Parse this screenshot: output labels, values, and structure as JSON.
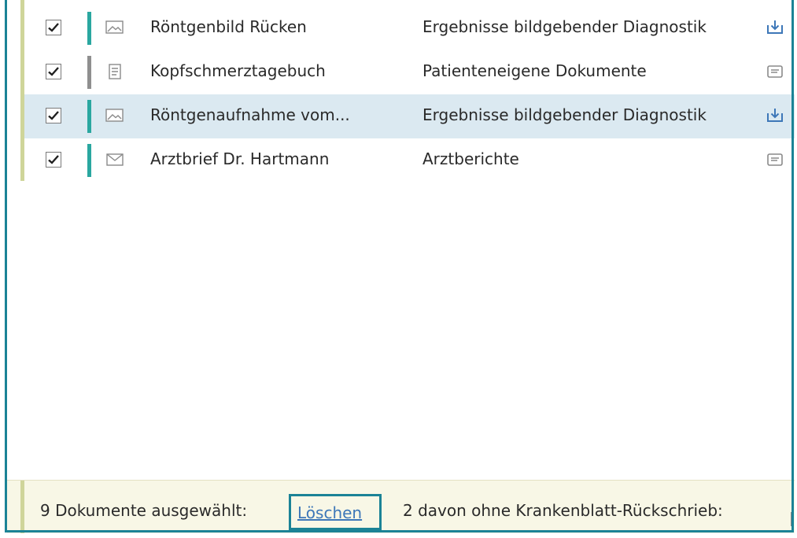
{
  "colors": {
    "accent": "#1b8396",
    "selected_row": "#dbe9f1",
    "link": "#3d77b8",
    "footer_bg": "#f8f7e6",
    "type_teal": "#2aa7a0",
    "type_gray": "#8f8f8f"
  },
  "documents": [
    {
      "checked": true,
      "type_color": "teal",
      "icon": "image-icon",
      "name": "Röntgenbild Rücken",
      "category": "Ergebnisse bildgebender Diagnostik",
      "action_icon": "download-icon",
      "selected": false
    },
    {
      "checked": true,
      "type_color": "gray",
      "icon": "document-icon",
      "name": "Kopfschmerztagebuch",
      "category": "Patienteneigene Dokumente",
      "action_icon": "folder-icon",
      "selected": false
    },
    {
      "checked": true,
      "type_color": "teal",
      "icon": "image-icon",
      "name": "Röntgenaufnahme vom...",
      "category": "Ergebnisse bildgebender Diagnostik",
      "action_icon": "download-icon",
      "selected": true
    },
    {
      "checked": true,
      "type_color": "teal",
      "icon": "mail-icon",
      "name": "Arztbrief Dr. Hartmann",
      "category": "Arztberichte",
      "action_icon": "folder-icon",
      "selected": false
    }
  ],
  "footer": {
    "selected_count_text": "9 Dokumente ausgewählt:",
    "delete_label": "Löschen",
    "without_sheet_text": "2 davon ohne Krankenblatt-Rückschrieb:"
  }
}
